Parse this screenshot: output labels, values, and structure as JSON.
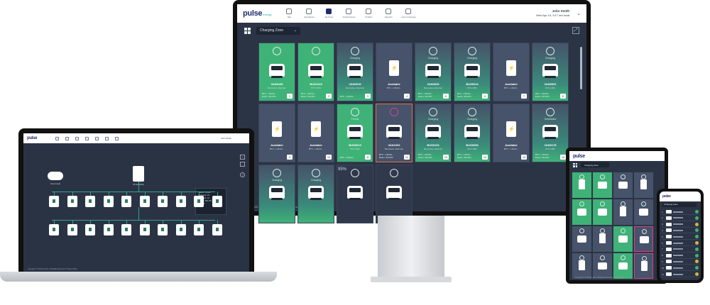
{
  "app": {
    "brand": "pulse",
    "brand_sub": "energy",
    "nav": [
      {
        "label": "Site",
        "icon": "site-icon"
      },
      {
        "label": "Operations",
        "icon": "operations-icon"
      },
      {
        "label": "My Fleet",
        "icon": "fleet-icon",
        "active": true
      },
      {
        "label": "Infrastructure",
        "icon": "infrastructure-icon"
      },
      {
        "label": "Profiles",
        "icon": "profiles-icon"
      },
      {
        "label": "Reports",
        "icon": "reports-icon"
      },
      {
        "label": "Cost & Savings",
        "icon": "cost-icon"
      }
    ],
    "user": {
      "name": "John Smith",
      "detail": "Wed Apr 19, 9:17 am local"
    },
    "zone_select": "Charging Zone",
    "footer": "© 2023 bp pulse. All Rights Reserved. Privacy Policy",
    "battery": "95%",
    "tiles": [
      {
        "style": "green",
        "status": "",
        "type": "vehicle",
        "name": "VAN0108",
        "sub": "Mercedes eSprinter",
        "info1": "BTC - L36-02...",
        "info2": "Exam: 36 kWh",
        "num": "1"
      },
      {
        "style": "green",
        "status": "",
        "type": "bus",
        "name": "BUS1023",
        "sub": "BYD C8M",
        "info1": "BTC - L36-02...",
        "info2": "Exam: 36 kWh",
        "num": "2"
      },
      {
        "style": "teal",
        "status": "Charging",
        "type": "vehicle",
        "name": "VAN0019",
        "sub": "Mercedes eSprinter",
        "info1": "BTC - L36-02...",
        "info2": "",
        "num": "3"
      },
      {
        "style": "default",
        "status": "",
        "type": "charger",
        "name": "Available",
        "sub": "BTC - L36-02...",
        "info1": "",
        "info2": "",
        "num": "4"
      },
      {
        "style": "teal",
        "status": "Charging",
        "type": "vehicle",
        "name": "VAN0025",
        "sub": "Mercedes eSprinter",
        "info1": "BTC - L36-02...",
        "info2": "Exam: 36 kWh",
        "num": "5"
      },
      {
        "style": "teal",
        "status": "Charging",
        "type": "bus",
        "name": "BUS0016",
        "sub": "BYD C8M",
        "info1": "BTC - L36-02...",
        "info2": "Exam: 36 kWh",
        "num": "6"
      },
      {
        "style": "default",
        "status": "",
        "type": "charger",
        "name": "Available",
        "sub": "BTC - L36-02...",
        "info1": "",
        "info2": "",
        "num": "7"
      },
      {
        "style": "teal",
        "status": "Charging",
        "type": "vehicle",
        "name": "VAN0002",
        "sub": "BYD C8M",
        "info1": "BTC - L36-02...",
        "info2": "Exam: 36 kWh",
        "num": "8"
      },
      {
        "style": "default",
        "status": "",
        "type": "charger",
        "name": "Available",
        "sub": "BTC - L36-02...",
        "info1": "",
        "info2": "",
        "num": "9"
      },
      {
        "style": "default",
        "status": "",
        "type": "charger",
        "name": "Available",
        "sub": "BTC - L36-02...",
        "info1": "",
        "info2": "",
        "num": "10"
      },
      {
        "style": "green",
        "status": "Priority",
        "type": "bus",
        "name": "BUS0019",
        "sub": "BYD C8M",
        "info1": "BTC - L36-02...",
        "info2": "",
        "num": "11"
      },
      {
        "style": "alert",
        "status": "",
        "type": "vehicle",
        "name": "VAN1002",
        "sub": "Mercedes eSprinter",
        "info1": "BTC - L36-02...",
        "info2": "Exam: 36 kWh",
        "num": "12"
      },
      {
        "style": "teal",
        "status": "Charging",
        "type": "vehicle",
        "name": "BUS0192",
        "sub": "Mercedes eSprinter",
        "info1": "BTC - L36-02...",
        "info2": "Exam: 36 kWh",
        "num": "13"
      },
      {
        "style": "teal",
        "status": "Charging",
        "type": "bus",
        "name": "BUS0056",
        "sub": "BYD C8M",
        "info1": "BTC - L36-02...",
        "info2": "Exam: 36 kWh",
        "num": "14"
      },
      {
        "style": "default",
        "status": "",
        "type": "charger",
        "name": "Available",
        "sub": "BTC - L36-02...",
        "info1": "",
        "info2": "",
        "num": "15"
      },
      {
        "style": "teal",
        "status": "Scheduled",
        "type": "vehicle",
        "name": "VAN0178",
        "sub": "BYD C8M",
        "info1": "BTC - L36-02...",
        "info2": "Exam: 36 kWh",
        "num": "16"
      },
      {
        "style": "teal",
        "status": "Charging",
        "type": "vehicle",
        "name": "",
        "sub": "",
        "info1": "",
        "info2": "",
        "num": ""
      },
      {
        "style": "teal",
        "status": "Charging",
        "type": "bus",
        "name": "",
        "sub": "",
        "info1": "",
        "info2": "",
        "num": ""
      },
      {
        "style": "dark",
        "status": "",
        "type": "vehicle",
        "name": "",
        "sub": "",
        "info1": "",
        "info2": "",
        "num": ""
      },
      {
        "style": "dark",
        "status": "",
        "type": "bus",
        "name": "",
        "sub": "",
        "info1": "",
        "info2": "",
        "num": ""
      }
    ]
  },
  "laptop": {
    "cloud_label": "Cloud Apis",
    "hub_label": "SITEINFRA",
    "popup_lines": [
      "Status: Online",
      "Charging: 22",
      "Available: 10",
      "Power: 350 kW",
      "Fault: 0"
    ],
    "footer": "Copyright © 2023 bp pulse. All Rights Reserved. Privacy Policy",
    "controls": [
      "+",
      "-",
      "?"
    ]
  },
  "tablet": {
    "zone_select": "Charging Zone",
    "footer": "Copyright © 2023 bp pulse. All Rights Reserved. Privacy Policy",
    "tiles": [
      "green",
      "green",
      "default",
      "default",
      "green",
      "green",
      "default",
      "default",
      "default",
      "default",
      "green",
      "alert",
      "default",
      "default",
      "green",
      "alert"
    ]
  },
  "phone": {
    "zone_select": "Charging Zone",
    "rows": [
      {
        "n": "1",
        "status": "green"
      },
      {
        "n": "2",
        "status": "green"
      },
      {
        "n": "3",
        "status": "yellow"
      },
      {
        "n": "4",
        "status": "green"
      },
      {
        "n": "5",
        "status": "green"
      },
      {
        "n": "6",
        "status": "yellow"
      },
      {
        "n": "7",
        "status": "green"
      },
      {
        "n": "8",
        "status": "green"
      },
      {
        "n": "9",
        "status": "yellow"
      },
      {
        "n": "10",
        "status": "green"
      },
      {
        "n": "11",
        "status": "yellow"
      }
    ]
  },
  "colors": {
    "accent_green": "#3fb277",
    "panel": "#2b3445",
    "tile": "#46536a",
    "alert": "#d2448b",
    "brand": "#1f2d6e"
  }
}
